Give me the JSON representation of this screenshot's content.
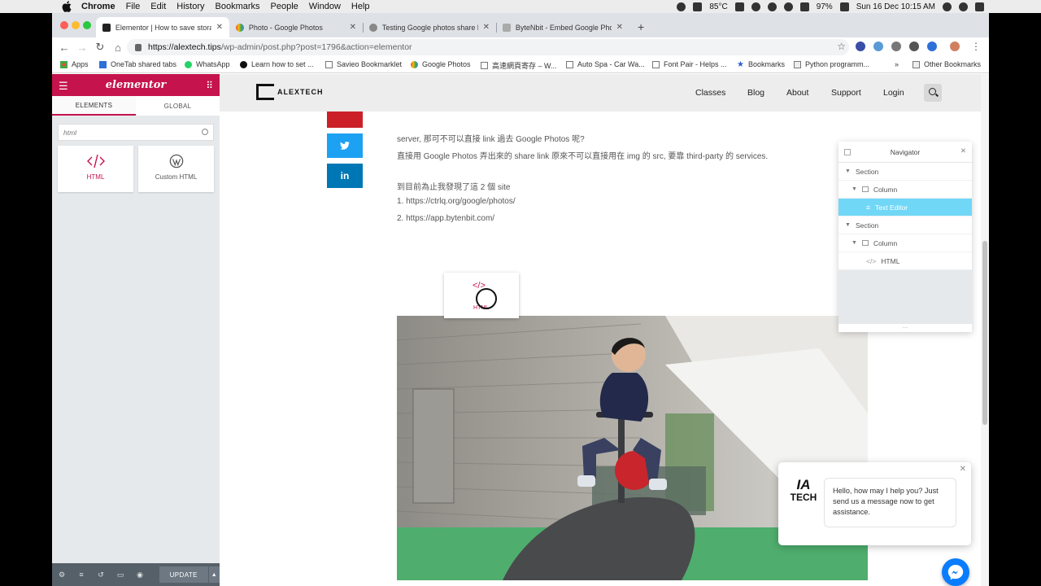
{
  "menubar": {
    "app": "Chrome",
    "items": [
      "File",
      "Edit",
      "History",
      "Bookmarks",
      "People",
      "Window",
      "Help"
    ],
    "temperature": "85°C",
    "battery": "97%",
    "datetime": "Sun 16 Dec  10:15 AM"
  },
  "tabs": [
    {
      "title": "Elementor | How to save storag",
      "active": true
    },
    {
      "title": "Photo - Google Photos",
      "active": false
    },
    {
      "title": "Testing Google photos share li",
      "active": false
    },
    {
      "title": "ByteNbit - Embed Google Phot",
      "active": false
    }
  ],
  "address": {
    "host": "https://alextech.tips",
    "path": "/wp-admin/post.php?post=1796&action=elementor"
  },
  "bookmarks": [
    "Apps",
    "OneTab shared tabs",
    "WhatsApp",
    "Learn how to set ...",
    "Savieo Bookmarklet",
    "Google Photos",
    "高速網頁寄存 – W...",
    "Auto Spa - Car Wa...",
    "Font Pair - Helps ...",
    "Bookmarks",
    "Python programm...",
    "»",
    "Other Bookmarks"
  ],
  "panel": {
    "logo": "elementor",
    "tab_elements": "ELEMENTS",
    "tab_global": "GLOBAL",
    "search_value": "html",
    "widget_html": "HTML",
    "widget_custom_html": "Custom HTML",
    "update_label": "UPDATE"
  },
  "site": {
    "logo_text": "ALEXTECH",
    "nav": [
      "Classes",
      "Blog",
      "About",
      "Support",
      "Login"
    ],
    "share_twitter": "t",
    "share_linkedin": "in",
    "paragraphs": [
      "server, 那可不可以直接 link 過去 Google Photos 呢?",
      "直接用 Google Photos 弄出來的 share link 原來不可以直接用在 img 的 src, 要靠 third-party 的 services.",
      "到目前為止我發現了這 2 個 site",
      "1. https://ctrlq.org/google/photos/",
      "2. https://app.bytenbit.com/"
    ],
    "drag_label": "HTML"
  },
  "navigator": {
    "title": "Navigator",
    "rows": [
      {
        "label": "Section",
        "level": 0
      },
      {
        "label": "Column",
        "level": 1
      },
      {
        "label": "Text Editor",
        "level": 2,
        "selected": true
      },
      {
        "label": "Section",
        "level": 0
      },
      {
        "label": "Column",
        "level": 1
      },
      {
        "label": "HTML",
        "level": 2
      }
    ],
    "footer": "..."
  },
  "chat": {
    "logo_mark": "IA",
    "logo_text": "TECH",
    "message": "Hello, how may I help you? Just send us a message now to get assistance."
  },
  "colors": {
    "elementor_brand": "#c5134e",
    "navigator_selected": "#71d7f7",
    "twitter": "#1da1f2",
    "linkedin": "#0077b5",
    "messenger": "#0a7cff"
  }
}
